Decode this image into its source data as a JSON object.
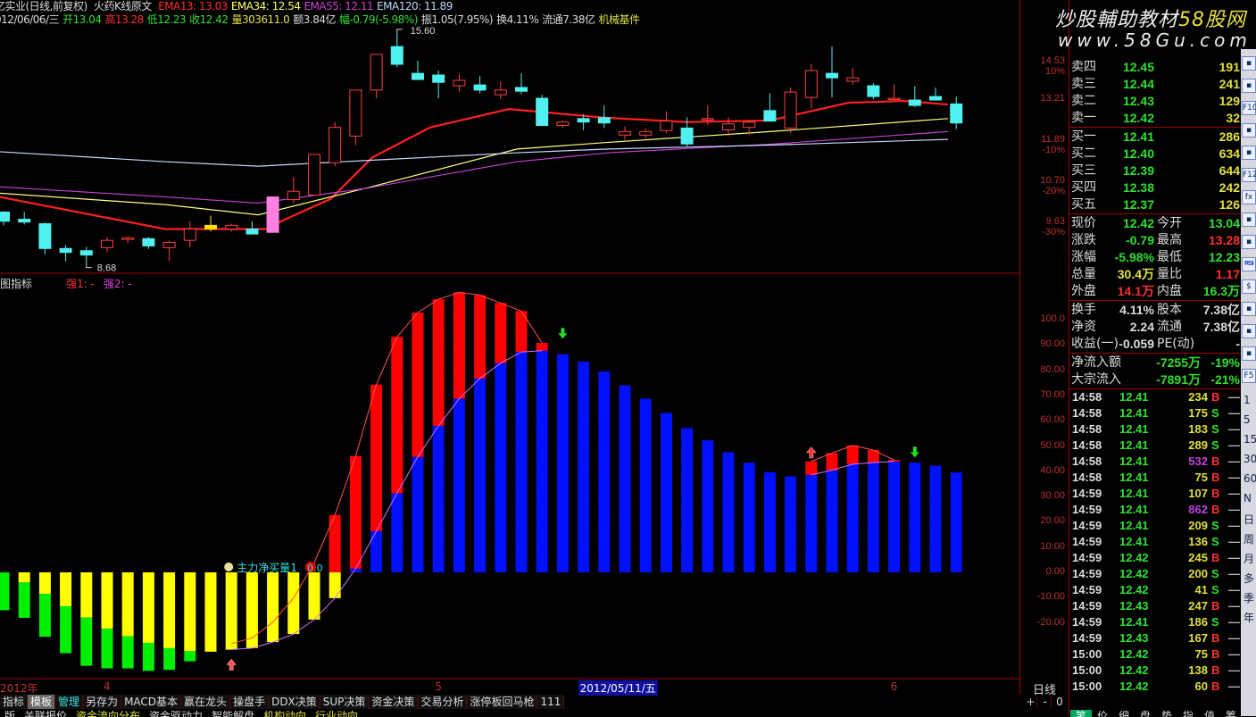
{
  "header": {
    "title": "亿实业(日线,前复权)",
    "formula": "火药K线原文",
    "ema": [
      {
        "label": "EMA13: 13.03",
        "color": "#ff3030"
      },
      {
        "label": "EMA34: 12.54",
        "color": "#ffff60"
      },
      {
        "label": "EMA55: 12.11",
        "color": "#d040d0"
      },
      {
        "label": "EMA120: 11.89",
        "color": "#c0d8ff"
      }
    ],
    "info": [
      {
        "text": "012/06/06/三",
        "color": "#dddddd"
      },
      {
        "text": "开13.04",
        "color": "#30e030"
      },
      {
        "text": "高13.28",
        "color": "#ff3030"
      },
      {
        "text": "低12.23",
        "color": "#30e030"
      },
      {
        "text": "收12.42",
        "color": "#30e030"
      },
      {
        "text": "量303611.0",
        "color": "#e0e040"
      },
      {
        "text": "额3.84亿",
        "color": "#dddddd"
      },
      {
        "text": "幅-0.79(-5.98%)",
        "color": "#30e030"
      },
      {
        "text": "振1.05(7.95%)",
        "color": "#dddddd"
      },
      {
        "text": "换4.11%",
        "color": "#dddddd"
      },
      {
        "text": "流通7.38亿",
        "color": "#dddddd"
      },
      {
        "text": "机械基件",
        "color": "#e0e040"
      }
    ]
  },
  "watermark": {
    "line1": "炒股輔助教材",
    "brand": "58股网",
    "line2": "www.58Gu.com"
  },
  "price_chart": {
    "high_label": "15.60",
    "low_label": "8.68",
    "axis": [
      {
        "price": 14.53,
        "label": "14.53",
        "pct": "10%"
      },
      {
        "price": 13.21,
        "label": "13.21",
        "pct": ""
      },
      {
        "price": 11.89,
        "label": "11.89",
        "pct": "-10%"
      },
      {
        "price": 10.7,
        "label": "10.70",
        "pct": "-20%"
      },
      {
        "price": 9.63,
        "label": "9.63",
        "pct": "-30%"
      }
    ],
    "candles": [
      [
        9.89,
        9.91,
        9.56,
        9.66
      ],
      [
        9.71,
        9.89,
        9.58,
        9.64
      ],
      [
        9.6,
        9.62,
        8.88,
        9.01
      ],
      [
        9.01,
        9.09,
        8.72,
        8.92
      ],
      [
        8.96,
        9.05,
        8.68,
        8.86
      ],
      [
        9.03,
        9.28,
        8.92,
        9.2
      ],
      [
        9.22,
        9.3,
        9.13,
        9.26
      ],
      [
        9.24,
        9.28,
        9.0,
        9.07
      ],
      [
        9.03,
        9.2,
        8.72,
        9.15
      ],
      [
        9.2,
        9.66,
        9.03,
        9.47
      ],
      [
        9.47,
        9.8,
        9.41,
        9.56,
        "yellow"
      ],
      [
        9.47,
        9.6,
        9.41,
        9.56
      ],
      [
        9.47,
        9.66,
        9.35,
        9.35
      ],
      [
        9.39,
        10.28,
        9.39,
        10.28,
        "pink"
      ],
      [
        10.21,
        10.82,
        10.12,
        10.43
      ],
      [
        10.33,
        11.46,
        10.33,
        11.46
      ],
      [
        11.22,
        12.45,
        11.12,
        12.28
      ],
      [
        12.01,
        13.51,
        11.74,
        13.51
      ],
      [
        13.51,
        14.8,
        13.23,
        14.8
      ],
      [
        15.1,
        15.6,
        14.33,
        14.43
      ],
      [
        14.1,
        14.56,
        13.88,
        13.88
      ],
      [
        14.04,
        14.2,
        13.23,
        13.78
      ],
      [
        13.66,
        14.07,
        13.44,
        13.85
      ],
      [
        13.69,
        14.0,
        13.4,
        13.51
      ],
      [
        13.35,
        13.8,
        13.2,
        13.51
      ],
      [
        13.6,
        14.1,
        13.38,
        13.47
      ],
      [
        13.23,
        13.35,
        12.34,
        12.34
      ],
      [
        12.34,
        12.5,
        12.26,
        12.45
      ],
      [
        12.56,
        12.7,
        12.2,
        12.45
      ],
      [
        12.59,
        13.0,
        12.26,
        12.42
      ],
      [
        12.04,
        12.3,
        11.9,
        12.15
      ],
      [
        12.04,
        12.25,
        11.95,
        12.15
      ],
      [
        12.18,
        12.8,
        12.1,
        12.48
      ],
      [
        12.26,
        12.6,
        11.7,
        11.77
      ],
      [
        12.53,
        13.0,
        12.35,
        12.56
      ],
      [
        12.2,
        12.6,
        12.0,
        12.39
      ],
      [
        12.28,
        12.5,
        12.05,
        12.45
      ],
      [
        12.82,
        13.4,
        12.48,
        12.48
      ],
      [
        12.26,
        13.6,
        12.1,
        13.44
      ],
      [
        13.26,
        14.45,
        12.9,
        14.2
      ],
      [
        14.1,
        15.1,
        13.26,
        13.94
      ],
      [
        13.82,
        14.3,
        13.7,
        13.94
      ],
      [
        13.66,
        13.75,
        13.2,
        13.29
      ],
      [
        13.23,
        13.7,
        13.2,
        13.23
      ],
      [
        13.17,
        13.65,
        12.93,
        12.99
      ],
      [
        13.29,
        13.6,
        13.2,
        13.17
      ],
      [
        13.04,
        13.28,
        12.23,
        12.42
      ]
    ],
    "ma_lines": [
      {
        "name": "EMA13",
        "color": "#ff2020",
        "points": [
          [
            -0.2,
            10.28
          ],
          [
            7.8,
            9.47
          ],
          [
            12.8,
            9.47
          ],
          [
            13.4,
            9.66
          ],
          [
            15.8,
            10.23
          ],
          [
            17.8,
            11.37
          ],
          [
            20.6,
            12.28
          ],
          [
            24.4,
            12.87
          ],
          [
            29,
            12.59
          ],
          [
            33,
            12.45
          ],
          [
            37,
            12.5
          ],
          [
            40.8,
            13.08
          ],
          [
            43.5,
            13.14
          ],
          [
            45.6,
            13.02
          ]
        ]
      },
      {
        "name": "EMA34",
        "color": "#ffff80",
        "points": [
          [
            -0.2,
            10.38
          ],
          [
            7.8,
            10.08
          ],
          [
            12.3,
            9.82
          ],
          [
            17.4,
            10.5
          ],
          [
            24.8,
            11.62
          ],
          [
            29.2,
            11.82
          ],
          [
            37,
            12.15
          ],
          [
            45.6,
            12.56
          ]
        ]
      },
      {
        "name": "EMA55",
        "color": "#c040d0",
        "points": [
          [
            -0.2,
            10.55
          ],
          [
            7.8,
            10.28
          ],
          [
            12.3,
            10.12
          ],
          [
            17.4,
            10.5
          ],
          [
            24.8,
            11.25
          ],
          [
            29.2,
            11.51
          ],
          [
            37.2,
            11.77
          ],
          [
            45.6,
            12.15
          ]
        ]
      },
      {
        "name": "EMA120",
        "color": "#c8d8ff",
        "points": [
          [
            -0.2,
            11.54
          ],
          [
            7.8,
            11.25
          ],
          [
            12.3,
            11.12
          ],
          [
            17.4,
            11.28
          ],
          [
            24.8,
            11.51
          ],
          [
            29.2,
            11.62
          ],
          [
            37.2,
            11.74
          ],
          [
            45.6,
            11.91
          ]
        ]
      }
    ]
  },
  "indicator": {
    "title": "副图指标",
    "legend": [
      {
        "text": "强1: -",
        "color": "#ff3030"
      },
      {
        "text": "强2: -",
        "color": "#e040e0"
      }
    ],
    "axis": [
      100,
      90,
      80,
      70,
      60,
      50,
      40,
      30,
      20,
      10,
      0,
      -10,
      -20
    ],
    "axis_labels": [
      "100.0",
      "90.00",
      "80.00",
      "70.00",
      "60.00",
      "50.00",
      "40.00",
      "30.00",
      "20.00",
      "10.00",
      "0.00",
      "-10.00",
      "-20.00"
    ],
    "bars": [
      {
        "g": -15
      },
      {
        "y": -4,
        "g": -18
      },
      {
        "y": -8.5,
        "g": -25.5
      },
      {
        "y": -13.4,
        "g": -32
      },
      {
        "y": -17.9,
        "g": -37
      },
      {
        "y": -22.3,
        "g": -38
      },
      {
        "y": -25.3,
        "g": -38
      },
      {
        "y": -27.9,
        "g": -39
      },
      {
        "y": -30,
        "g": -38.6
      },
      {
        "y": -31.2,
        "g": -35.2
      },
      {
        "y": -31.4
      },
      {
        "y": -30.6
      },
      {
        "y": -30
      },
      {
        "y": -27.6
      },
      {
        "y": -24.4
      },
      {
        "y": -18.7
      },
      {
        "y": -10.2,
        "r": 22.7
      },
      {
        "b": 1.5,
        "r": 46
      },
      {
        "b": 16.3,
        "r": 74.3
      },
      {
        "b": 31.3,
        "r": 93.2
      },
      {
        "b": 45.7,
        "r": 102.8
      },
      {
        "b": 58,
        "r": 108.1
      },
      {
        "b": 68.7,
        "r": 110.8
      },
      {
        "b": 76.7,
        "r": 109.7
      },
      {
        "b": 82.8,
        "r": 106.6
      },
      {
        "b": 87.2,
        "r": 103.4
      },
      {
        "b": 87.7,
        "r": 90.8
      },
      {
        "b": 86.3
      },
      {
        "b": 83.4
      },
      {
        "b": 79.5
      },
      {
        "b": 74
      },
      {
        "b": 68.7
      },
      {
        "b": 63.1
      },
      {
        "b": 57.1
      },
      {
        "b": 52.2
      },
      {
        "b": 47.5
      },
      {
        "b": 43.4
      },
      {
        "b": 39.6
      },
      {
        "b": 38
      },
      {
        "b": 38.6,
        "r": 43.9
      },
      {
        "b": 40.4,
        "r": 47.2
      },
      {
        "b": 42.8,
        "r": 50.2
      },
      {
        "b": 43.4,
        "r": 48.4
      },
      {
        "b": 43.9,
        "r": 44.5
      },
      {
        "b": 43.4
      },
      {
        "b": 42.2
      },
      {
        "b": 39.5
      }
    ],
    "strong1": [
      [
        11,
        -28.2
      ],
      [
        12,
        -26
      ],
      [
        13,
        -19.7
      ],
      [
        14,
        -10.2
      ],
      [
        15,
        3.9
      ],
      [
        16,
        22.7
      ],
      [
        17,
        46
      ],
      [
        18,
        74.3
      ],
      [
        19,
        93.2
      ],
      [
        20,
        102.8
      ],
      [
        21,
        108.1
      ],
      [
        22,
        110.8
      ],
      [
        23,
        109.7
      ],
      [
        24,
        106.6
      ],
      [
        25,
        103.4
      ],
      [
        26,
        90.8
      ],
      null,
      [
        39,
        43.9
      ],
      [
        40,
        47.2
      ],
      [
        41,
        50.2
      ],
      [
        42,
        48.4
      ],
      [
        43,
        44.5
      ]
    ],
    "strong2": [
      [
        11,
        -30.5
      ],
      [
        12,
        -30
      ],
      [
        13,
        -27.6
      ],
      [
        14,
        -24.4
      ],
      [
        15,
        -18.7
      ],
      [
        16,
        -10.2
      ],
      [
        17,
        1.5
      ],
      [
        18,
        16.3
      ],
      [
        19,
        31.3
      ],
      [
        20,
        45.7
      ],
      [
        21,
        58
      ],
      [
        22,
        68.7
      ],
      [
        23,
        76.7
      ],
      [
        24,
        82.8
      ],
      [
        25,
        87.2
      ],
      [
        26,
        87.7
      ],
      null,
      [
        39,
        38.6
      ],
      [
        40,
        40.4
      ],
      [
        41,
        42.8
      ],
      [
        42,
        43.4
      ],
      [
        43,
        43.9
      ]
    ],
    "signal_label": "主力净买量1",
    "signal_value": "0.0",
    "buy_arrows": [
      11,
      39
    ],
    "sell_arrows": [
      {
        "bar": 27,
        "value": 96
      },
      {
        "bar": 44,
        "value": 49
      }
    ]
  },
  "date_axis": [
    {
      "bar": 0,
      "label": "2012年"
    },
    {
      "bar": 5,
      "label": "4"
    },
    {
      "bar": 21,
      "label": "5"
    },
    {
      "bar": 43,
      "label": "6"
    }
  ],
  "cursor_date": {
    "bar": 28,
    "label": "2012/05/11/五"
  },
  "period_label": "日线",
  "zoom_controls": [
    "+",
    "-",
    "0"
  ],
  "orderbook": {
    "asks": [
      {
        "label": "卖四",
        "price": "12.45",
        "vol": "191"
      },
      {
        "label": "卖三",
        "price": "12.44",
        "vol": "241"
      },
      {
        "label": "卖二",
        "price": "12.43",
        "vol": "129"
      },
      {
        "label": "卖一",
        "price": "12.42",
        "vol": "32"
      }
    ],
    "bids": [
      {
        "label": "买一",
        "price": "12.41",
        "vol": "286"
      },
      {
        "label": "买二",
        "price": "12.40",
        "vol": "634"
      },
      {
        "label": "买三",
        "price": "12.39",
        "vol": "644"
      },
      {
        "label": "买四",
        "price": "12.38",
        "vol": "242"
      },
      {
        "label": "买五",
        "price": "12.37",
        "vol": "126"
      }
    ]
  },
  "quote": [
    {
      "l1": "现价",
      "v1": "12.42",
      "c1": "#30e030",
      "l2": "今开",
      "v2": "13.04",
      "c2": "#30e030"
    },
    {
      "l1": "涨跌",
      "v1": "-0.79",
      "c1": "#30e030",
      "l2": "最高",
      "v2": "13.28",
      "c2": "#ff3030"
    },
    {
      "l1": "涨幅",
      "v1": "-5.98%",
      "c1": "#30e030",
      "l2": "最低",
      "v2": "12.23",
      "c2": "#30e030"
    },
    {
      "l1": "总量",
      "v1": "30.4万",
      "c1": "#e0e040",
      "l2": "量比",
      "v2": "1.17",
      "c2": "#ff3030"
    },
    {
      "l1": "外盘",
      "v1": "14.1万",
      "c1": "#ff3030",
      "l2": "内盘",
      "v2": "16.3万",
      "c2": "#30e030"
    }
  ],
  "fundamentals": [
    {
      "l1": "换手",
      "v1": "4.11%",
      "l2": "股本",
      "v2": "7.38亿"
    },
    {
      "l1": "净资",
      "v1": "2.24",
      "l2": "流通",
      "v2": "7.38亿"
    },
    {
      "l1": "收益(一)",
      "v1": "-0.059",
      "l2": "PE(动)",
      "v2": "-"
    }
  ],
  "flows": [
    {
      "label": "净流入额",
      "amount": "-7255万",
      "pct": "-19%"
    },
    {
      "label": "大宗流入",
      "amount": "-7891万",
      "pct": "-21%"
    }
  ],
  "ticks": [
    {
      "time": "14:58",
      "price": "12.41",
      "vol": "234",
      "side": "B",
      "big": false
    },
    {
      "time": "14:58",
      "price": "12.41",
      "vol": "175",
      "side": "S",
      "big": false
    },
    {
      "time": "14:58",
      "price": "12.41",
      "vol": "183",
      "side": "S",
      "big": false
    },
    {
      "time": "14:58",
      "price": "12.41",
      "vol": "289",
      "side": "S",
      "big": false
    },
    {
      "time": "14:58",
      "price": "12.41",
      "vol": "532",
      "side": "B",
      "big": true
    },
    {
      "time": "14:58",
      "price": "12.41",
      "vol": "75",
      "side": "B",
      "big": false
    },
    {
      "time": "14:59",
      "price": "12.41",
      "vol": "107",
      "side": "B",
      "big": false
    },
    {
      "time": "14:59",
      "price": "12.41",
      "vol": "862",
      "side": "B",
      "big": true
    },
    {
      "time": "14:59",
      "price": "12.41",
      "vol": "209",
      "side": "S",
      "big": false
    },
    {
      "time": "14:59",
      "price": "12.41",
      "vol": "136",
      "side": "S",
      "big": false
    },
    {
      "time": "14:59",
      "price": "12.42",
      "vol": "245",
      "side": "B",
      "big": false
    },
    {
      "time": "14:59",
      "price": "12.42",
      "vol": "200",
      "side": "S",
      "big": false
    },
    {
      "time": "14:59",
      "price": "12.42",
      "vol": "41",
      "side": "S",
      "big": false
    },
    {
      "time": "14:59",
      "price": "12.43",
      "vol": "247",
      "side": "B",
      "big": false
    },
    {
      "time": "14:59",
      "price": "12.41",
      "vol": "186",
      "side": "S",
      "big": false
    },
    {
      "time": "14:59",
      "price": "12.43",
      "vol": "167",
      "side": "B",
      "big": false
    },
    {
      "time": "15:00",
      "price": "12.42",
      "vol": "75",
      "side": "B",
      "big": false
    },
    {
      "time": "15:00",
      "price": "12.42",
      "vol": "138",
      "side": "B",
      "big": false
    },
    {
      "time": "15:00",
      "price": "12.42",
      "vol": "60",
      "side": "B",
      "big": false
    }
  ],
  "tick_dash": "—",
  "side_icons": [
    "candle-chart",
    "list",
    "F10",
    "folder",
    "note",
    "F12",
    "fx",
    "zoom",
    "wave",
    "RSI",
    "dollar",
    "move",
    "plus",
    "pencil",
    "F5"
  ],
  "periods": [
    "1",
    "5",
    "15",
    "30",
    "60",
    "N",
    "日",
    "周",
    "月",
    "多",
    "季",
    "年"
  ],
  "tabs": [
    {
      "label": "指标"
    },
    {
      "label": "模板",
      "state": "active"
    },
    {
      "label": "管理",
      "state": "sel"
    },
    {
      "label": "另存为"
    },
    {
      "label": "MACD基本"
    },
    {
      "label": "赢在龙头"
    },
    {
      "label": "操盘手"
    },
    {
      "label": "DDX决策"
    },
    {
      "label": "SUP决策"
    },
    {
      "label": "资金决策"
    },
    {
      "label": "交易分析"
    },
    {
      "label": "涨停板回马枪"
    },
    {
      "label": "111"
    }
  ],
  "tabs2": [
    {
      "label": "版"
    },
    {
      "label": "关联报价"
    },
    {
      "label": "资金流向分布",
      "y": true
    },
    {
      "label": "资金驱动力"
    },
    {
      "label": "智能解盘"
    },
    {
      "label": "机构动向",
      "y": true
    },
    {
      "label": "行业动向",
      "y": true
    }
  ],
  "bottom_tabs": [
    "笔",
    "价",
    "细",
    "盘",
    "势",
    "指",
    "值",
    "筹"
  ]
}
